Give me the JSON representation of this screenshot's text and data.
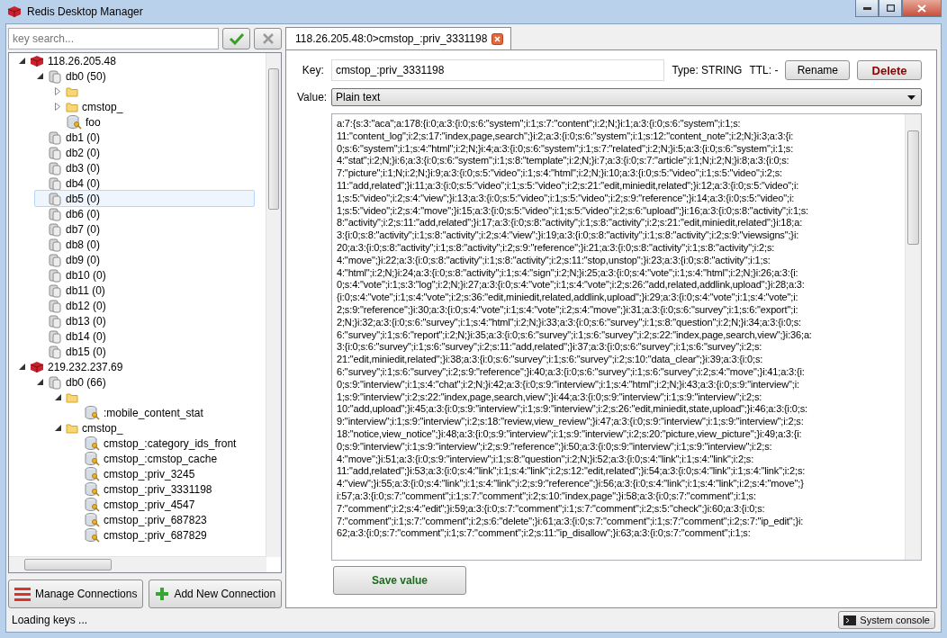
{
  "window": {
    "title": "Redis Desktop Manager"
  },
  "search": {
    "placeholder": "key search..."
  },
  "tree": [
    {
      "kind": "server",
      "label": "118.26.205.48",
      "expanded": true,
      "selected": false,
      "children": [
        {
          "kind": "db",
          "label": "db0 (50)",
          "expanded": true,
          "selected": false,
          "children": [
            {
              "kind": "folder",
              "expanded": false,
              "selected": false
            },
            {
              "kind": "folder",
              "label": "cmstop_",
              "expanded": false,
              "selected": false
            },
            {
              "kind": "key",
              "label": "foo",
              "selected": false
            }
          ]
        },
        {
          "kind": "db",
          "label": "db1 (0)",
          "selected": false
        },
        {
          "kind": "db",
          "label": "db2 (0)",
          "selected": false
        },
        {
          "kind": "db",
          "label": "db3 (0)",
          "selected": false
        },
        {
          "kind": "db",
          "label": "db4 (0)",
          "selected": false
        },
        {
          "kind": "db",
          "label": "db5 (0)",
          "selected": true
        },
        {
          "kind": "db",
          "label": "db6 (0)",
          "selected": false
        },
        {
          "kind": "db",
          "label": "db7 (0)",
          "selected": false
        },
        {
          "kind": "db",
          "label": "db8 (0)",
          "selected": false
        },
        {
          "kind": "db",
          "label": "db9 (0)",
          "selected": false
        },
        {
          "kind": "db",
          "label": "db10 (0)",
          "selected": false
        },
        {
          "kind": "db",
          "label": "db11 (0)",
          "selected": false
        },
        {
          "kind": "db",
          "label": "db12 (0)",
          "selected": false
        },
        {
          "kind": "db",
          "label": "db13 (0)",
          "selected": false
        },
        {
          "kind": "db",
          "label": "db14 (0)",
          "selected": false
        },
        {
          "kind": "db",
          "label": "db15 (0)",
          "selected": false
        }
      ]
    },
    {
      "kind": "server",
      "label": "219.232.237.69",
      "expanded": true,
      "selected": false,
      "children": [
        {
          "kind": "db",
          "label": "db0 (66)",
          "expanded": true,
          "selected": false,
          "children": [
            {
              "kind": "folder",
              "expanded": true,
              "selected": false,
              "children": [
                {
                  "kind": "key",
                  "label": ":mobile_content_stat",
                  "selected": false
                }
              ]
            },
            {
              "kind": "folder",
              "label": "cmstop_",
              "expanded": true,
              "selected": false,
              "children": [
                {
                  "kind": "key",
                  "label": "cmstop_:category_ids_front",
                  "selected": false
                },
                {
                  "kind": "key",
                  "label": "cmstop_:cmstop_cache",
                  "selected": false
                },
                {
                  "kind": "key",
                  "label": "cmstop_:priv_3245",
                  "selected": false
                },
                {
                  "kind": "key",
                  "label": "cmstop_:priv_3331198",
                  "selected": false
                },
                {
                  "kind": "key",
                  "label": "cmstop_:priv_4547",
                  "selected": false
                },
                {
                  "kind": "key",
                  "label": "cmstop_:priv_687823",
                  "selected": false
                },
                {
                  "kind": "key",
                  "label": "cmstop_:priv_687829",
                  "selected": false
                }
              ]
            }
          ]
        }
      ]
    }
  ],
  "connection_buttons": [
    "Manage Connections",
    "Add New Connection"
  ],
  "status_bar": {
    "text": "Loading keys ...",
    "console_button": "System console"
  },
  "tabs": [
    {
      "label": "118.26.205.48:0>cmstop_:priv_3331198",
      "selected": true
    }
  ],
  "key_panel": {
    "key_label": "Key:",
    "key_value": "cmstop_:priv_3331198",
    "type": "Type: STRING",
    "ttl": "TTL: -",
    "rename_button": "Rename",
    "delete_button": "Delete",
    "value_label": "Value:",
    "format": "Plain text",
    "save_button": "Save value"
  },
  "value_lines": [
    "a:7:{s:3:\"aca\";a:178:{i:0;a:3:{i:0;s:6:\"system\";i:1;s:7:\"content\";i:2;N;}i:1;a:3:{i:0;s:6:\"system\";i:1;s:",
    "11:\"content_log\";i:2;s:17:\"index,page,search\";}i:2;a:3:{i:0;s:6:\"system\";i:1;s:12:\"content_note\";i:2;N;}i:3;a:3:{i:",
    "0;s:6:\"system\";i:1;s:4:\"html\";i:2;N;}i:4;a:3:{i:0;s:6:\"system\";i:1;s:7:\"related\";i:2;N;}i:5;a:3:{i:0;s:6:\"system\";i:1;s:",
    "4:\"stat\";i:2;N;}i:6;a:3:{i:0;s:6:\"system\";i:1;s:8:\"template\";i:2;N;}i:7;a:3:{i:0;s:7:\"article\";i:1;N;i:2;N;}i:8;a:3:{i:0;s:",
    "7:\"picture\";i:1;N;i:2;N;}i:9;a:3:{i:0;s:5:\"video\";i:1;s:4:\"html\";i:2;N;}i:10;a:3:{i:0;s:5:\"video\";i:1;s:5:\"video\";i:2;s:",
    "11:\"add,related\";}i:11;a:3:{i:0;s:5:\"video\";i:1;s:5:\"video\";i:2;s:21:\"edit,miniedit,related\";}i:12;a:3:{i:0;s:5:\"video\";i:",
    "1;s:5:\"video\";i:2;s:4:\"view\";}i:13;a:3:{i:0;s:5:\"video\";i:1;s:5:\"video\";i:2;s:9:\"reference\";}i:14;a:3:{i:0;s:5:\"video\";i:",
    "1;s:5:\"video\";i:2;s:4:\"move\";}i:15;a:3:{i:0;s:5:\"video\";i:1;s:5:\"video\";i:2;s:6:\"upload\";}i:16;a:3:{i:0;s:8:\"activity\";i:1;s:",
    "8:\"activity\";i:2;s:11:\"add,related\";}i:17;a:3:{i:0;s:8:\"activity\";i:1;s:8:\"activity\";i:2;s:21:\"edit,miniedit,related\";}i:18;a:",
    "3:{i:0;s:8:\"activity\";i:1;s:8:\"activity\";i:2;s:4:\"view\";}i:19;a:3:{i:0;s:8:\"activity\";i:1;s:8:\"activity\";i:2;s:9:\"viewsigns\";}i:",
    "20;a:3:{i:0;s:8:\"activity\";i:1;s:8:\"activity\";i:2;s:9:\"reference\";}i:21;a:3:{i:0;s:8:\"activity\";i:1;s:8:\"activity\";i:2;s:",
    "4:\"move\";}i:22;a:3:{i:0;s:8:\"activity\";i:1;s:8:\"activity\";i:2;s:11:\"stop,unstop\";}i:23;a:3:{i:0;s:8:\"activity\";i:1;s:",
    "4:\"html\";i:2;N;}i:24;a:3:{i:0;s:8:\"activity\";i:1;s:4:\"sign\";i:2;N;}i:25;a:3:{i:0;s:4:\"vote\";i:1;s:4:\"html\";i:2;N;}i:26;a:3:{i:",
    "0;s:4:\"vote\";i:1;s:3:\"log\";i:2;N;}i:27;a:3:{i:0;s:4:\"vote\";i:1;s:4:\"vote\";i:2;s:26:\"add,related,addlink,upload\";}i:28;a:3:",
    "{i:0;s:4:\"vote\";i:1;s:4:\"vote\";i:2;s:36:\"edit,miniedit,related,addlink,upload\";}i:29;a:3:{i:0;s:4:\"vote\";i:1;s:4:\"vote\";i:",
    "2;s:9:\"reference\";}i:30;a:3:{i:0;s:4:\"vote\";i:1;s:4:\"vote\";i:2;s:4:\"move\";}i:31;a:3:{i:0;s:6:\"survey\";i:1;s:6:\"export\";i:",
    "2;N;}i:32;a:3:{i:0;s:6:\"survey\";i:1;s:4:\"html\";i:2;N;}i:33;a:3:{i:0;s:6:\"survey\";i:1;s:8:\"question\";i:2;N;}i:34;a:3:{i:0;s:",
    "6:\"survey\";i:1;s:6:\"report\";i:2;N;}i:35;a:3:{i:0;s:6:\"survey\";i:1;s:6:\"survey\";i:2;s:22:\"index,page,search,view\";}i:36;a:",
    "3:{i:0;s:6:\"survey\";i:1;s:6:\"survey\";i:2;s:11:\"add,related\";}i:37;a:3:{i:0;s:6:\"survey\";i:1;s:6:\"survey\";i:2;s:",
    "21:\"edit,miniedit,related\";}i:38;a:3:{i:0;s:6:\"survey\";i:1;s:6:\"survey\";i:2;s:10:\"data_clear\";}i:39;a:3:{i:0;s:",
    "6:\"survey\";i:1;s:6:\"survey\";i:2;s:9:\"reference\";}i:40;a:3:{i:0;s:6:\"survey\";i:1;s:6:\"survey\";i:2;s:4:\"move\";}i:41;a:3:{i:",
    "0;s:9:\"interview\";i:1;s:4:\"chat\";i:2;N;}i:42;a:3:{i:0;s:9:\"interview\";i:1;s:4:\"html\";i:2;N;}i:43;a:3:{i:0;s:9:\"interview\";i:",
    "1;s:9:\"interview\";i:2;s:22:\"index,page,search,view\";}i:44;a:3:{i:0;s:9:\"interview\";i:1;s:9:\"interview\";i:2;s:",
    "10:\"add,upload\";}i:45;a:3:{i:0;s:9:\"interview\";i:1;s:9:\"interview\";i:2;s:26:\"edit,miniedit,state,upload\";}i:46;a:3:{i:0;s:",
    "9:\"interview\";i:1;s:9:\"interview\";i:2;s:18:\"review,view_review\";}i:47;a:3:{i:0;s:9:\"interview\";i:1;s:9:\"interview\";i:2;s:",
    "18:\"notice,view_notice\";}i:48;a:3:{i:0;s:9:\"interview\";i:1;s:9:\"interview\";i:2;s:20:\"picture,view_picture\";}i:49;a:3:{i:",
    "0;s:9:\"interview\";i:1;s:9:\"interview\";i:2;s:9:\"reference\";}i:50;a:3:{i:0;s:9:\"interview\";i:1;s:9:\"interview\";i:2;s:",
    "4:\"move\";}i:51;a:3:{i:0;s:9:\"interview\";i:1;s:8:\"question\";i:2;N;}i:52;a:3:{i:0;s:4:\"link\";i:1;s:4:\"link\";i:2;s:",
    "11:\"add,related\";}i:53;a:3:{i:0;s:4:\"link\";i:1;s:4:\"link\";i:2;s:12:\"edit,related\";}i:54;a:3:{i:0;s:4:\"link\";i:1;s:4:\"link\";i:2;s:",
    "4:\"view\";}i:55;a:3:{i:0;s:4:\"link\";i:1;s:4:\"link\";i:2;s:9:\"reference\";}i:56;a:3:{i:0;s:4:\"link\";i:1;s:4:\"link\";i:2;s:4:\"move\";}",
    "i:57;a:3:{i:0;s:7:\"comment\";i:1;s:7:\"comment\";i:2;s:10:\"index,page\";}i:58;a:3:{i:0;s:7:\"comment\";i:1;s:",
    "7:\"comment\";i:2;s:4:\"edit\";}i:59;a:3:{i:0;s:7:\"comment\";i:1;s:7:\"comment\";i:2;s:5:\"check\";}i:60;a:3:{i:0;s:",
    "7:\"comment\";i:1;s:7:\"comment\";i:2;s:6:\"delete\";}i:61;a:3:{i:0;s:7:\"comment\";i:1;s:7:\"comment\";i:2;s:7:\"ip_edit\";}i:",
    "62;a:3:{i:0;s:7:\"comment\";i:1;s:7:\"comment\";i:2;s:11:\"ip_disallow\";}i:63;a:3:{i:0;s:7:\"comment\";i:1;s:"
  ]
}
